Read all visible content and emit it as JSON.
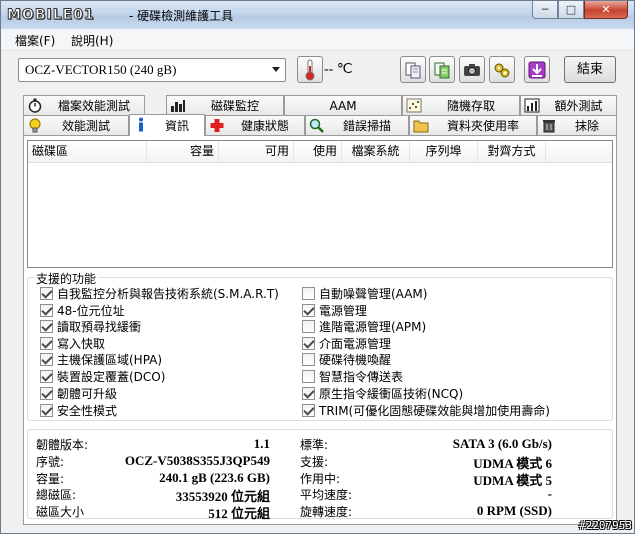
{
  "window": {
    "logo": "MOBILE01",
    "title": "- 硬碟檢測維護工具",
    "controls": [
      "─",
      "□",
      "✕"
    ]
  },
  "menu": {
    "file": "檔案(F)",
    "help": "說明(H)"
  },
  "toolbar": {
    "drive": "OCZ-VECTOR150 (240 gB)",
    "temperature": "-- ℃",
    "exit_label": "結束"
  },
  "tabs_top": [
    {
      "label": "檔案效能測試"
    },
    {
      "label": "磁碟監控"
    },
    {
      "label": "AAM"
    },
    {
      "label": "隨機存取"
    },
    {
      "label": "額外測試"
    }
  ],
  "tabs_bottom": [
    {
      "label": "效能測試"
    },
    {
      "label": "資訊"
    },
    {
      "label": "健康狀態"
    },
    {
      "label": "錯誤掃描"
    },
    {
      "label": "資料夾使用率"
    },
    {
      "label": "抹除"
    }
  ],
  "partition_table": {
    "columns": [
      "磁碟區",
      "容量",
      "可用",
      "使用",
      "檔案系統",
      "序列埠",
      "對齊方式"
    ]
  },
  "features": {
    "title": "支援的功能",
    "left": [
      {
        "label": "自我監控分析與報告技術系統(S.M.A.R.T)",
        "checked": true
      },
      {
        "label": "48-位元位址",
        "checked": true
      },
      {
        "label": "讀取預尋找緩衝",
        "checked": true
      },
      {
        "label": "寫入快取",
        "checked": true
      },
      {
        "label": "主機保護區域(HPA)",
        "checked": true
      },
      {
        "label": "裝置設定覆蓋(DCO)",
        "checked": true
      },
      {
        "label": "韌體可升級",
        "checked": true
      },
      {
        "label": "安全性模式",
        "checked": true
      }
    ],
    "right": [
      {
        "label": "自動噪聲管理(AAM)",
        "checked": false
      },
      {
        "label": "電源管理",
        "checked": true
      },
      {
        "label": "進階電源管理(APM)",
        "checked": false
      },
      {
        "label": "介面電源管理",
        "checked": true
      },
      {
        "label": "硬碟待機喚醒",
        "checked": false
      },
      {
        "label": "智慧指令傳送表",
        "checked": false
      },
      {
        "label": "原生指令緩衝區技術(NCQ)",
        "checked": true
      },
      {
        "label": "TRIM(可優化固態硬碟效能與增加使用壽命)",
        "checked": true
      }
    ]
  },
  "info": {
    "left": [
      {
        "label": "韌體版本:",
        "value": "1.1"
      },
      {
        "label": "序號:",
        "value": "OCZ-V5038S355J3QP549"
      },
      {
        "label": "容量:",
        "value": "240.1 gB (223.6 GB)"
      },
      {
        "label": "總磁區:",
        "value": "33553920 位元組"
      },
      {
        "label": "磁區大小",
        "value": "512 位元組"
      }
    ],
    "right": [
      {
        "label": "標準:",
        "value": "SATA 3 (6.0 Gb/s)"
      },
      {
        "label": "支援:",
        "value": "UDMA 模式 6"
      },
      {
        "label": "作用中:",
        "value": "UDMA 模式 5"
      },
      {
        "label": "平均速度:",
        "value": "-"
      },
      {
        "label": "旋轉速度:",
        "value": "0 RPM (SSD)"
      }
    ]
  },
  "watermark": "#2207953"
}
